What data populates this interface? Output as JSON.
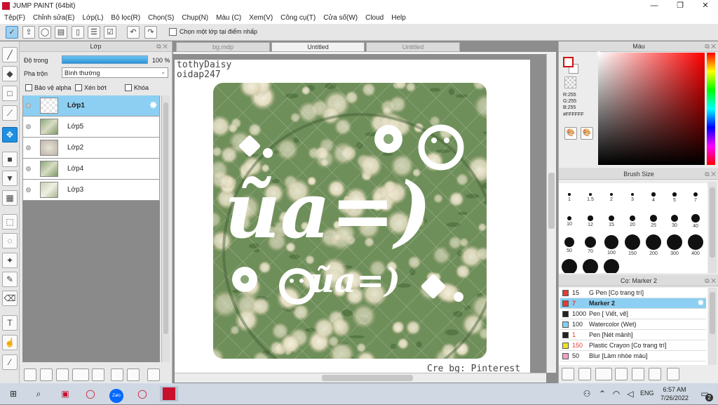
{
  "window": {
    "title": "JUMP PAINT (64bit)",
    "minimize": "—",
    "maximize": "❐",
    "close": "✕"
  },
  "menu": [
    "Tệp(F)",
    "Chỉnh sửa(E)",
    "Lớp(L)",
    "Bộ lọc(R)",
    "Chọn(S)",
    "Chụp(N)",
    "Màu (C)",
    "Xem(V)",
    "Công cụ(T)",
    "Cửa số(W)",
    "Cloud",
    "Help"
  ],
  "toolbar": {
    "snap_label": "Chọn một lớp tại điểm nhấp"
  },
  "layer_panel": {
    "title": "Lớp",
    "opacity_label": "Độ trong",
    "opacity_value": "100 %",
    "opacity": 1.0,
    "blend_label": "Pha trộn",
    "blend_value": "Bình thường",
    "protect_alpha": "Bảo vệ alpha",
    "clip": "Xén bớt",
    "lock": "Khóa",
    "layers": [
      {
        "name": "Lớp1",
        "selected": true
      },
      {
        "name": "Lớp5",
        "selected": false
      },
      {
        "name": "Lớp2",
        "selected": false
      },
      {
        "name": "Lớp4",
        "selected": false
      },
      {
        "name": "Lớp3",
        "selected": false
      }
    ]
  },
  "doc_tabs": [
    "bg.mdp",
    "Untitled",
    "Untitled"
  ],
  "canvas": {
    "credit_line1": "tothyDaisy",
    "credit_line2": "oidap247",
    "credit_bottom": "Cre bg: Pinterest",
    "big_text": "ũa=)",
    "small_text": "ũa=)"
  },
  "color_panel": {
    "title": "Màu",
    "r": "R:255",
    "g": "G:255",
    "b": "B:255",
    "hex": "#FFFFFF"
  },
  "brush_panel": {
    "title": "Brush Size",
    "sizes": [
      {
        "label": "1",
        "v": 1
      },
      {
        "label": "1.5",
        "v": 1.5
      },
      {
        "label": "2",
        "v": 2
      },
      {
        "label": "3",
        "v": 3
      },
      {
        "label": "4",
        "v": 4
      },
      {
        "label": "5",
        "v": 5
      },
      {
        "label": "7",
        "v": 7
      },
      {
        "label": "10",
        "v": 10
      },
      {
        "label": "12",
        "v": 12
      },
      {
        "label": "15",
        "v": 15
      },
      {
        "label": "20",
        "v": 20
      },
      {
        "label": "25",
        "v": 25
      },
      {
        "label": "30",
        "v": 30
      },
      {
        "label": "40",
        "v": 40
      },
      {
        "label": "50",
        "v": 50
      },
      {
        "label": "70",
        "v": 70
      },
      {
        "label": "100",
        "v": 100
      },
      {
        "label": "150",
        "v": 150
      },
      {
        "label": "200",
        "v": 200
      },
      {
        "label": "300",
        "v": 300
      },
      {
        "label": "400",
        "v": 400
      }
    ]
  },
  "preset_panel": {
    "title": "Cọ: Marker 2",
    "items": [
      {
        "size": "15",
        "name": "G Pen [Cọ trang trí]",
        "color": "#e53935",
        "sizecolor": "#222",
        "selected": false
      },
      {
        "size": "7",
        "name": "Marker 2",
        "color": "#e53935",
        "sizecolor": "#e53935",
        "selected": true
      },
      {
        "size": "1000",
        "name": "Pen [ Viết, vẽ]",
        "color": "#222222",
        "sizecolor": "#222",
        "selected": false
      },
      {
        "size": "100",
        "name": "Watercolor (Wet)",
        "color": "#7fd3f5",
        "sizecolor": "#222",
        "selected": false
      },
      {
        "size": "1",
        "name": "Pen [Nét mảnh]",
        "color": "#222222",
        "sizecolor": "#e53935",
        "selected": false
      },
      {
        "size": "150",
        "name": "Plastic Crayon [Cọ trang trí]",
        "color": "#f2e21b",
        "sizecolor": "#e53935",
        "selected": false
      },
      {
        "size": "50",
        "name": "Blur [Làm nhòe màu]",
        "color": "#f4a0c8",
        "sizecolor": "#222",
        "selected": false
      }
    ]
  },
  "taskbar": {
    "lang": "ENG",
    "time": "6:57 AM",
    "date": "7/26/2022",
    "notif_count": "2",
    "zalo_label": "Zalo"
  }
}
